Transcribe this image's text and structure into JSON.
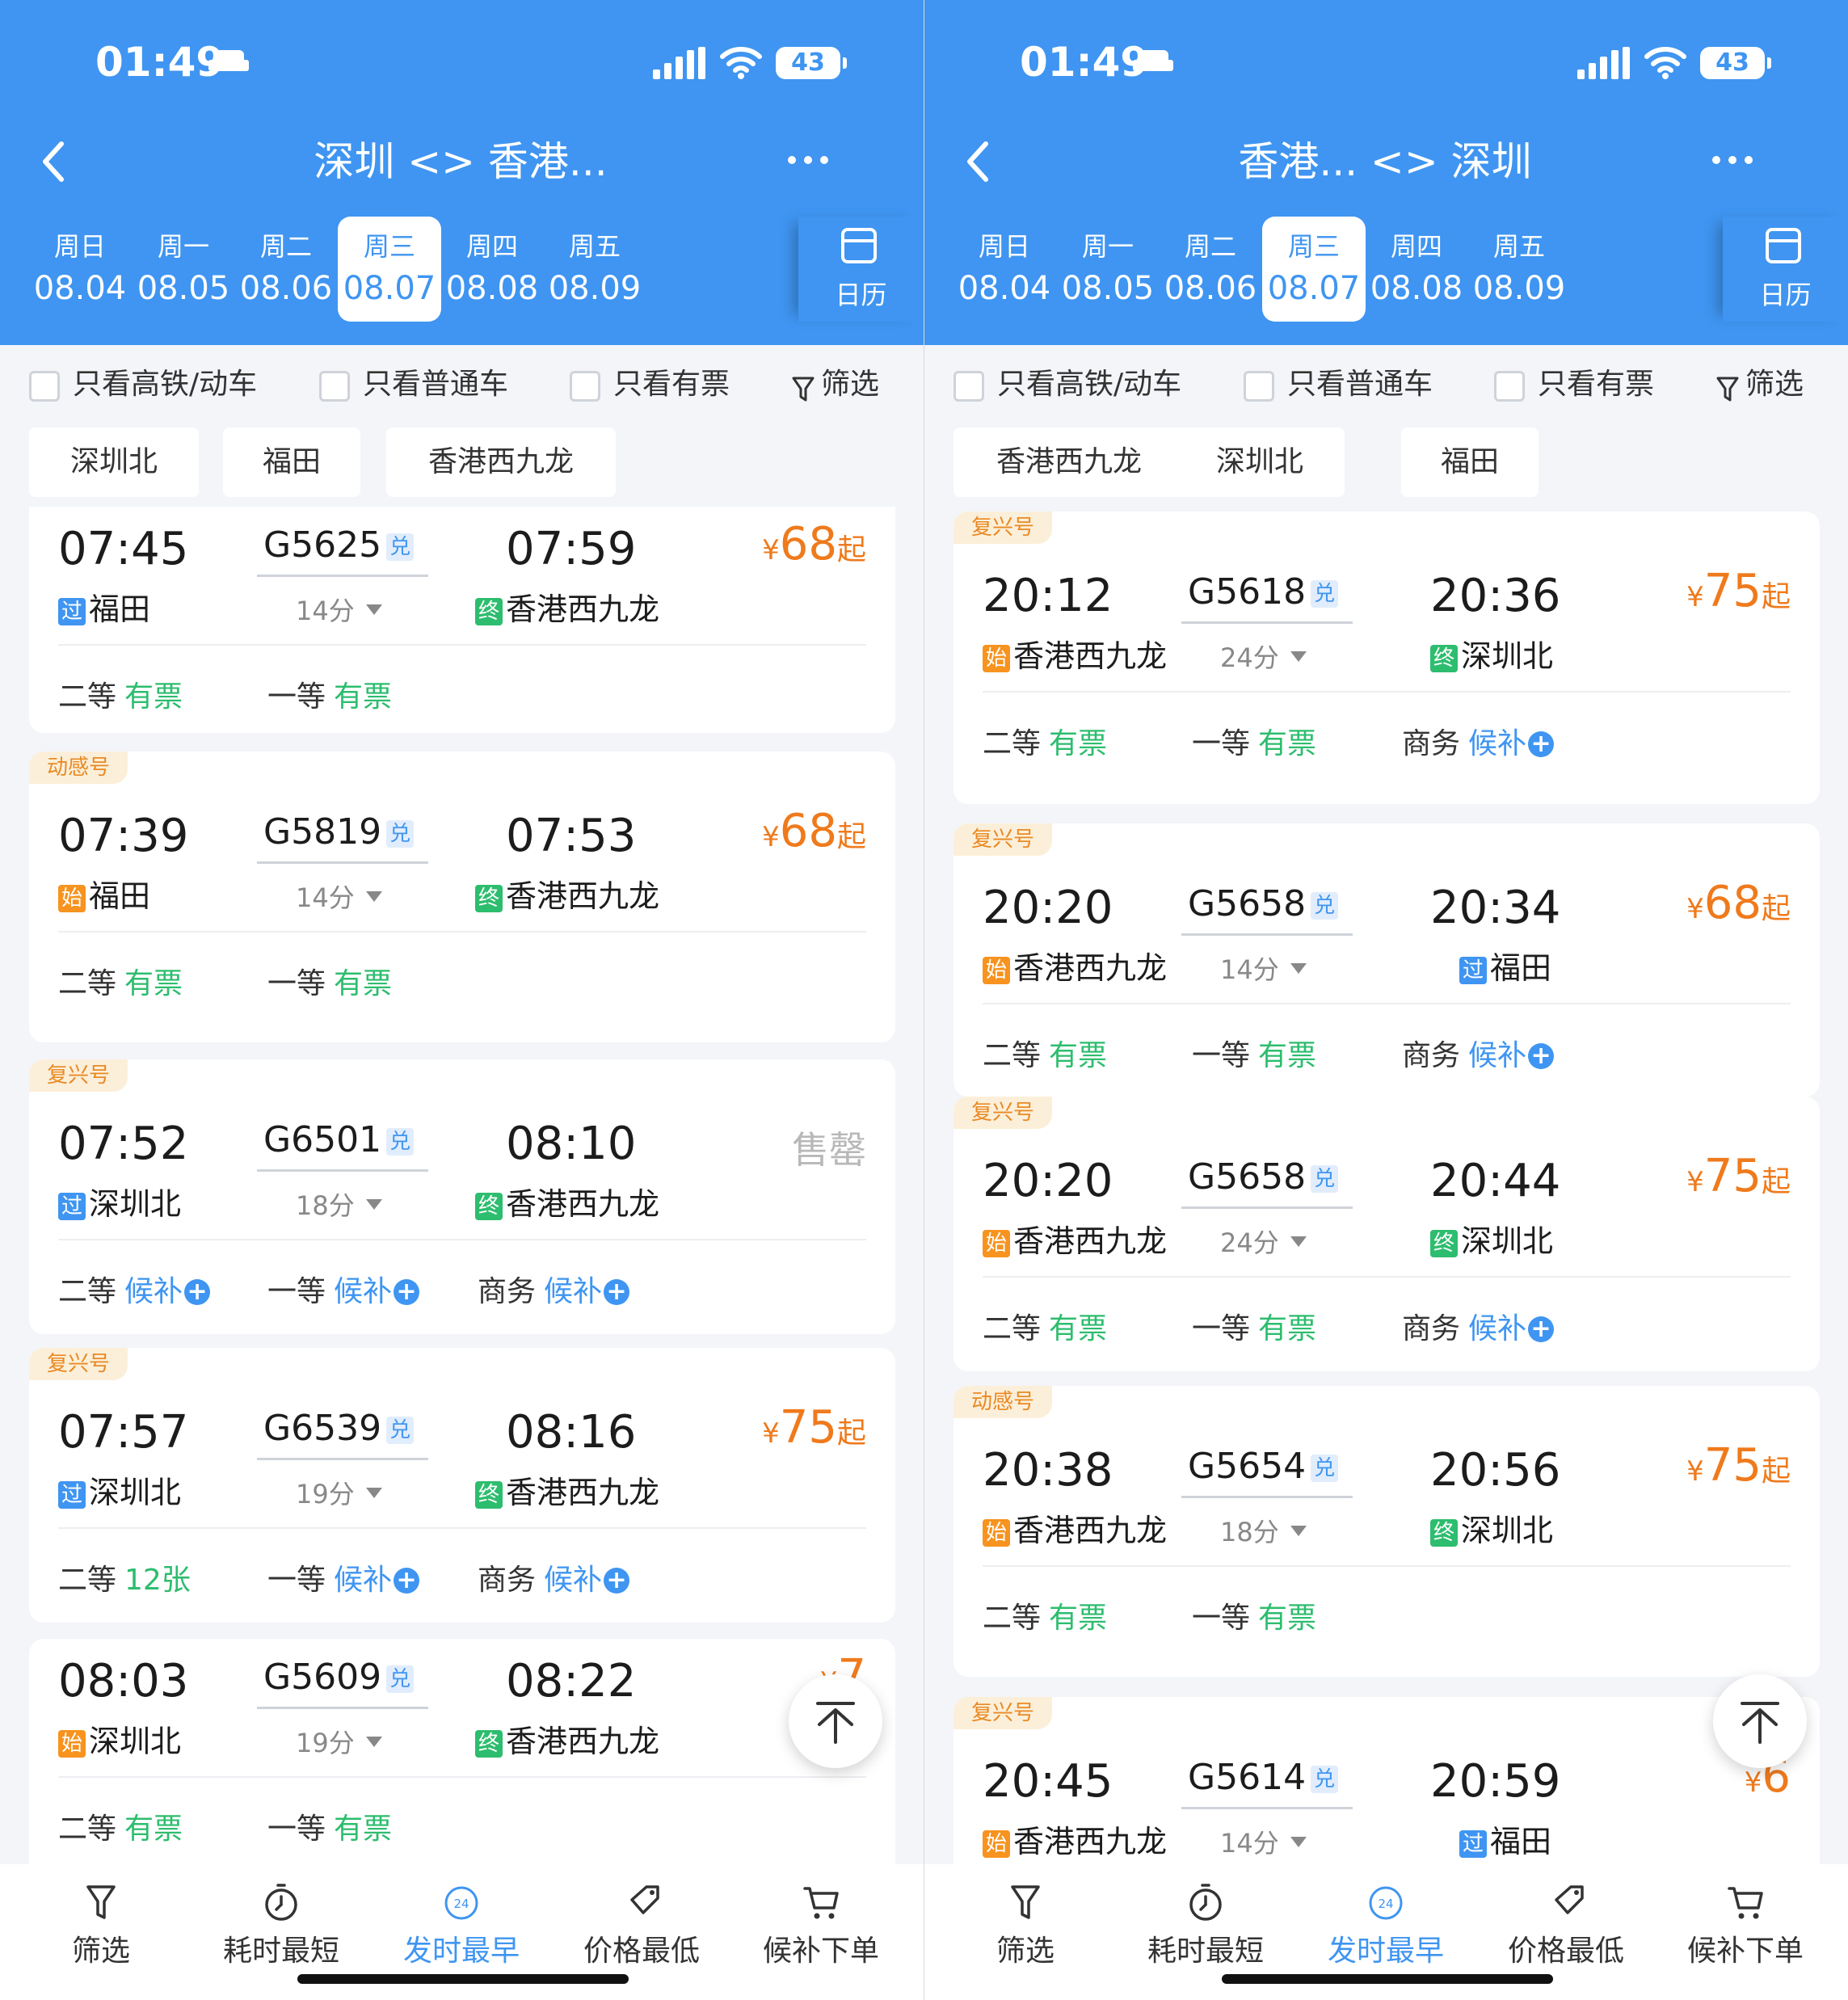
{
  "status": {
    "time": "01:49",
    "battery": "43"
  },
  "left": {
    "title": "深圳 <> 香港...",
    "dates": [
      {
        "w": "周日",
        "d": "08.04"
      },
      {
        "w": "周一",
        "d": "08.05"
      },
      {
        "w": "周二",
        "d": "08.06"
      },
      {
        "w": "周三",
        "d": "08.07"
      },
      {
        "w": "周四",
        "d": "08.08"
      },
      {
        "w": "周五",
        "d": "08.09"
      }
    ],
    "calendar": "日历",
    "filters": [
      "只看高铁/动车",
      "只看普通车",
      "只看有票"
    ],
    "filter_btn": "筛选",
    "stations": [
      "深圳北",
      "福田",
      "香港西九龙"
    ],
    "trains": [
      {
        "tag": "",
        "dep": "07:45",
        "no": "G5625",
        "dui": "兑",
        "arr": "07:59",
        "dur": "14分",
        "from_badge": "过",
        "from": "福田",
        "to_badge": "终",
        "to": "香港西九龙",
        "yen": "¥",
        "price": "68",
        "qi": "起",
        "soldout": "",
        "seats": [
          {
            "name": "二等",
            "status": "有票",
            "type": "ok"
          },
          {
            "name": "一等",
            "status": "有票",
            "type": "ok"
          }
        ]
      },
      {
        "tag": "动感号",
        "dep": "07:39",
        "no": "G5819",
        "dui": "兑",
        "arr": "07:53",
        "dur": "14分",
        "from_badge": "始",
        "from": "福田",
        "to_badge": "终",
        "to": "香港西九龙",
        "yen": "¥",
        "price": "68",
        "qi": "起",
        "soldout": "",
        "seats": [
          {
            "name": "二等",
            "status": "有票",
            "type": "ok"
          },
          {
            "name": "一等",
            "status": "有票",
            "type": "ok"
          }
        ]
      },
      {
        "tag": "复兴号",
        "dep": "07:52",
        "no": "G6501",
        "dui": "兑",
        "arr": "08:10",
        "dur": "18分",
        "from_badge": "过",
        "from": "深圳北",
        "to_badge": "终",
        "to": "香港西九龙",
        "yen": "",
        "price": "",
        "qi": "",
        "soldout": "售罄",
        "seats": [
          {
            "name": "二等",
            "status": "候补",
            "type": "wait"
          },
          {
            "name": "一等",
            "status": "候补",
            "type": "wait"
          },
          {
            "name": "商务",
            "status": "候补",
            "type": "wait"
          }
        ]
      },
      {
        "tag": "复兴号",
        "dep": "07:57",
        "no": "G6539",
        "dui": "兑",
        "arr": "08:16",
        "dur": "19分",
        "from_badge": "过",
        "from": "深圳北",
        "to_badge": "终",
        "to": "香港西九龙",
        "yen": "¥",
        "price": "75",
        "qi": "起",
        "soldout": "",
        "seats": [
          {
            "name": "二等",
            "status": "12张",
            "type": "ok"
          },
          {
            "name": "一等",
            "status": "候补",
            "type": "wait"
          },
          {
            "name": "商务",
            "status": "候补",
            "type": "wait"
          }
        ]
      },
      {
        "tag": "",
        "dep": "08:03",
        "no": "G5609",
        "dui": "兑",
        "arr": "08:22",
        "dur": "19分",
        "from_badge": "始",
        "from": "深圳北",
        "to_badge": "终",
        "to": "香港西九龙",
        "yen": "¥",
        "price": "7",
        "qi": "",
        "soldout": "",
        "seats": [
          {
            "name": "二等",
            "status": "有票",
            "type": "ok"
          },
          {
            "name": "一等",
            "status": "有票",
            "type": "ok"
          }
        ]
      }
    ]
  },
  "right": {
    "title": "香港... <> 深圳",
    "dates": [
      {
        "w": "周日",
        "d": "08.04"
      },
      {
        "w": "周一",
        "d": "08.05"
      },
      {
        "w": "周二",
        "d": "08.06"
      },
      {
        "w": "周三",
        "d": "08.07"
      },
      {
        "w": "周四",
        "d": "08.08"
      },
      {
        "w": "周五",
        "d": "08.09"
      }
    ],
    "calendar": "日历",
    "filters": [
      "只看高铁/动车",
      "只看普通车",
      "只看有票"
    ],
    "filter_btn": "筛选",
    "stations": [
      "香港西九龙",
      "深圳北",
      "福田"
    ],
    "trains": [
      {
        "tag": "复兴号",
        "dep": "20:12",
        "no": "G5618",
        "dui": "兑",
        "arr": "20:36",
        "dur": "24分",
        "from_badge": "始",
        "from": "香港西九龙",
        "to_badge": "终",
        "to": "深圳北",
        "yen": "¥",
        "price": "75",
        "qi": "起",
        "soldout": "",
        "seats": [
          {
            "name": "二等",
            "status": "有票",
            "type": "ok"
          },
          {
            "name": "一等",
            "status": "有票",
            "type": "ok"
          },
          {
            "name": "商务",
            "status": "候补",
            "type": "wait"
          }
        ]
      },
      {
        "tag": "复兴号",
        "dep": "20:20",
        "no": "G5658",
        "dui": "兑",
        "arr": "20:34",
        "dur": "14分",
        "from_badge": "始",
        "from": "香港西九龙",
        "to_badge": "过",
        "to": "福田",
        "yen": "¥",
        "price": "68",
        "qi": "起",
        "soldout": "",
        "seats": [
          {
            "name": "二等",
            "status": "有票",
            "type": "ok"
          },
          {
            "name": "一等",
            "status": "有票",
            "type": "ok"
          },
          {
            "name": "商务",
            "status": "候补",
            "type": "wait"
          }
        ]
      },
      {
        "tag": "复兴号",
        "dep": "20:20",
        "no": "G5658",
        "dui": "兑",
        "arr": "20:44",
        "dur": "24分",
        "from_badge": "始",
        "from": "香港西九龙",
        "to_badge": "终",
        "to": "深圳北",
        "yen": "¥",
        "price": "75",
        "qi": "起",
        "soldout": "",
        "seats": [
          {
            "name": "二等",
            "status": "有票",
            "type": "ok"
          },
          {
            "name": "一等",
            "status": "有票",
            "type": "ok"
          },
          {
            "name": "商务",
            "status": "候补",
            "type": "wait"
          }
        ]
      },
      {
        "tag": "动感号",
        "dep": "20:38",
        "no": "G5654",
        "dui": "兑",
        "arr": "20:56",
        "dur": "18分",
        "from_badge": "始",
        "from": "香港西九龙",
        "to_badge": "终",
        "to": "深圳北",
        "yen": "¥",
        "price": "75",
        "qi": "起",
        "soldout": "",
        "seats": [
          {
            "name": "二等",
            "status": "有票",
            "type": "ok"
          },
          {
            "name": "一等",
            "status": "有票",
            "type": "ok"
          }
        ]
      },
      {
        "tag": "复兴号",
        "dep": "20:45",
        "no": "G5614",
        "dui": "兑",
        "arr": "20:59",
        "dur": "14分",
        "from_badge": "始",
        "from": "香港西九龙",
        "to_badge": "过",
        "to": "福田",
        "yen": "¥",
        "price": "6",
        "qi": "",
        "soldout": "",
        "seats": []
      }
    ]
  },
  "tabs": [
    "筛选",
    "耗时最短",
    "发时最早",
    "价格最低",
    "候补下单"
  ],
  "tab_icon_label": "24",
  "active_tab": 2,
  "selected_date": 3,
  "colors": {
    "brand": "#3f95f1",
    "price": "#ef7a1c",
    "available": "#2dbd6e",
    "waitlist": "#3f95f1"
  }
}
